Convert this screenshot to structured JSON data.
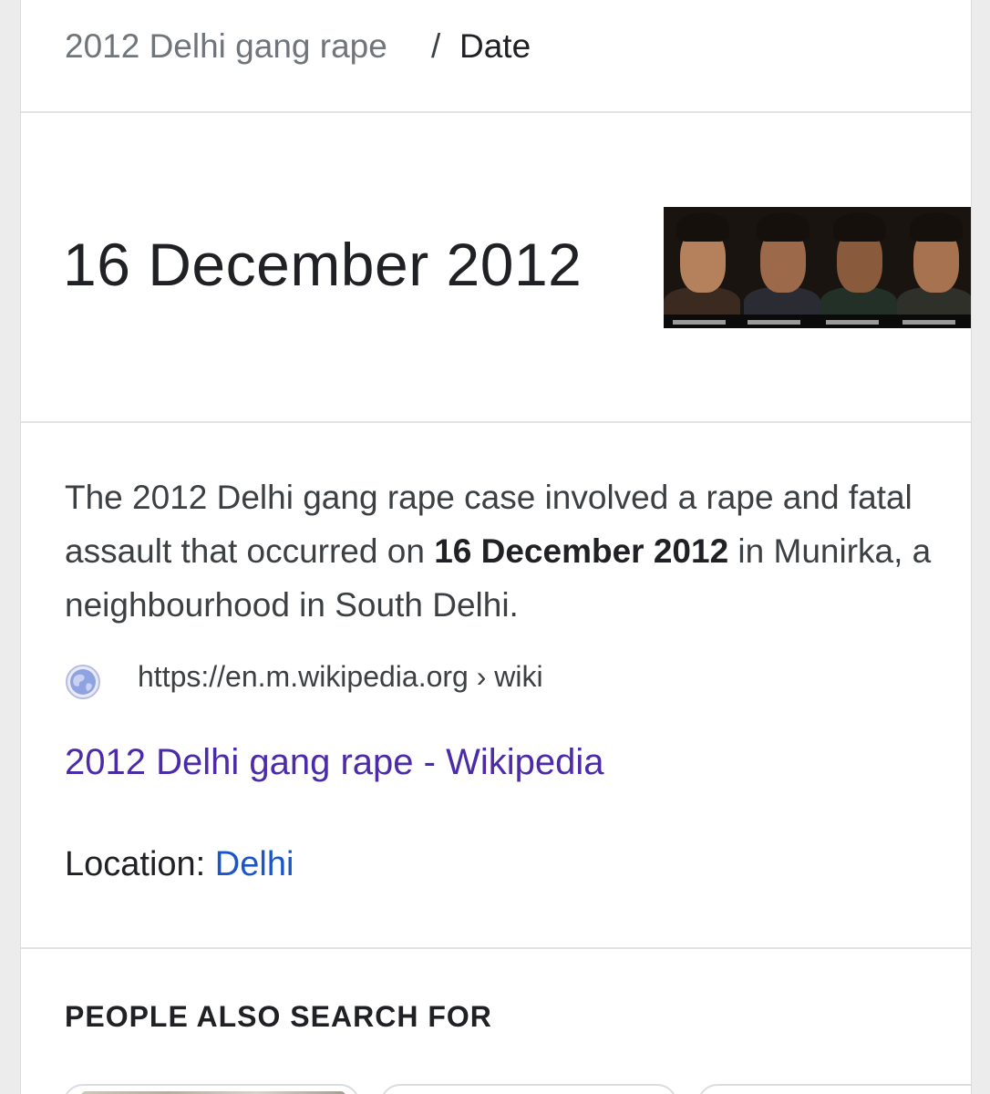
{
  "breadcrumb": {
    "link": "2012 Delhi gang rape",
    "separator": "/",
    "current": "Date"
  },
  "answer": {
    "date": "16 December 2012",
    "image_icon": "suspect-photos-thumbnail"
  },
  "snippet": {
    "text_before": "The 2012 Delhi gang rape case involved a rape and fatal assault that occurred on ",
    "bold": "16 December 2012",
    "text_after": " in Munirka, a neighbourhood in South Delhi."
  },
  "source": {
    "icon": "globe-icon",
    "url": "https://en.m.wikipedia.org › wiki",
    "title": "2012 Delhi gang rape - Wikipedia"
  },
  "location": {
    "label": "Location:",
    "value": "Delhi"
  },
  "people_also_search": {
    "heading": "PEOPLE ALSO SEARCH FOR"
  },
  "colors": {
    "link_visited": "#4b2ba8",
    "link": "#1a56c8",
    "text_primary": "#202124",
    "text_secondary": "#70757a"
  }
}
